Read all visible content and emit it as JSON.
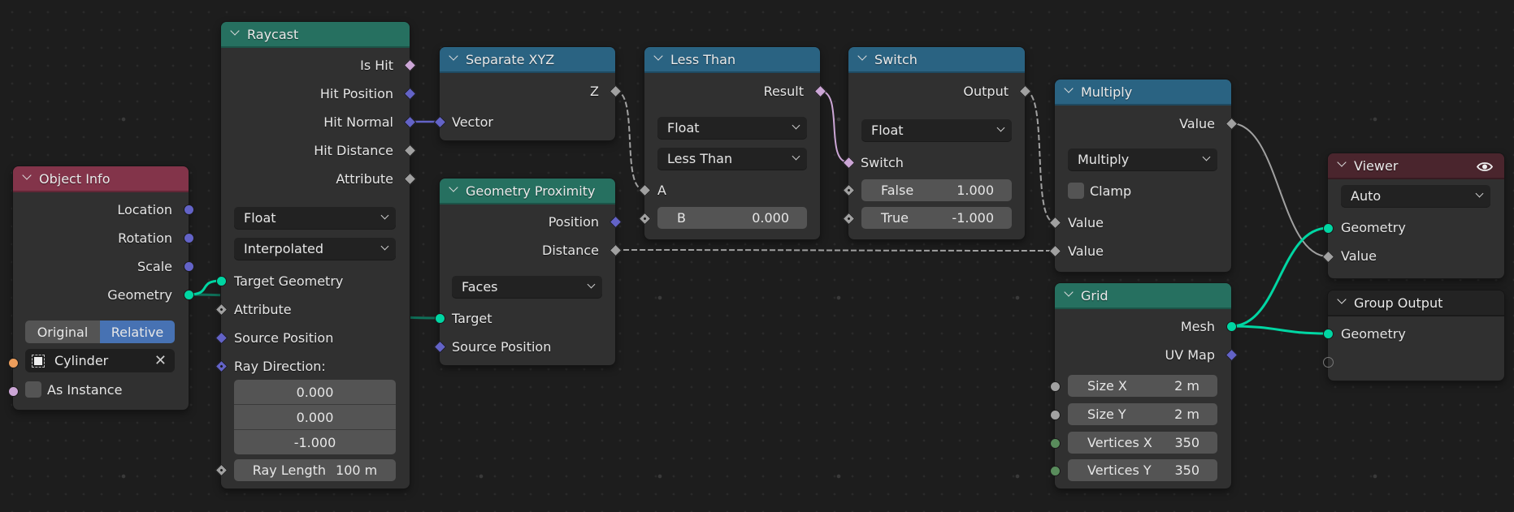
{
  "editor": "Geometry Node Editor",
  "colors": {
    "geometry_socket": "#00d6a3",
    "vector_socket": "#6363c7",
    "float_socket": "#a1a1a1",
    "boolean_socket": "#cca6d6",
    "object_socket": "#ed9e5c",
    "int_socket": "#598c5c",
    "geometry_header": "#267060",
    "converter_header": "#2a6382",
    "input_header": "#83344a",
    "output_header": "#4a252d",
    "toggle_active": "#4772b3"
  },
  "nodes": {
    "object_info": {
      "title": "Object Info",
      "outputs": [
        "Location",
        "Rotation",
        "Scale",
        "Geometry"
      ],
      "transform_space": {
        "options": [
          "Original",
          "Relative"
        ],
        "selected": "Relative"
      },
      "object": "Cylinder",
      "as_instance": {
        "label": "As Instance",
        "checked": false
      }
    },
    "raycast": {
      "title": "Raycast",
      "outputs": [
        "Is Hit",
        "Hit Position",
        "Hit Normal",
        "Hit Distance",
        "Attribute"
      ],
      "data_type": "Float",
      "mapping": "Interpolated",
      "inputs": [
        "Target Geometry",
        "Attribute",
        "Source Position",
        "Ray Direction:"
      ],
      "ray_direction": [
        "0.000",
        "0.000",
        "-1.000"
      ],
      "ray_length": {
        "label": "Ray Length",
        "value": "100 m"
      }
    },
    "separate_xyz": {
      "title": "Separate XYZ",
      "outputs": [
        "Z"
      ],
      "inputs": [
        "Vector"
      ]
    },
    "geometry_proximity": {
      "title": "Geometry Proximity",
      "outputs": [
        "Position",
        "Distance"
      ],
      "target_element": "Faces",
      "inputs": [
        "Target",
        "Source Position"
      ]
    },
    "less_than": {
      "title": "Less Than",
      "outputs": [
        "Result"
      ],
      "data_type": "Float",
      "operation": "Less Than",
      "inputs": [
        "A"
      ],
      "b": {
        "label": "B",
        "value": "0.000"
      }
    },
    "switch": {
      "title": "Switch",
      "outputs": [
        "Output"
      ],
      "data_type": "Float",
      "inputs": [
        "Switch"
      ],
      "false_field": {
        "label": "False",
        "value": "1.000"
      },
      "true_field": {
        "label": "True",
        "value": "-1.000"
      }
    },
    "multiply": {
      "title": "Multiply",
      "outputs": [
        "Value"
      ],
      "operation": "Multiply",
      "clamp": {
        "label": "Clamp",
        "checked": false
      },
      "inputs": [
        "Value",
        "Value"
      ]
    },
    "grid": {
      "title": "Grid",
      "outputs": [
        "Mesh",
        "UV Map"
      ],
      "fields": [
        {
          "label": "Size X",
          "value": "2 m"
        },
        {
          "label": "Size Y",
          "value": "2 m"
        },
        {
          "label": "Vertices X",
          "value": "350"
        },
        {
          "label": "Vertices Y",
          "value": "350"
        }
      ]
    },
    "viewer": {
      "title": "Viewer",
      "domain": "Auto",
      "inputs": [
        "Geometry",
        "Value"
      ]
    },
    "group_output": {
      "title": "Group Output",
      "inputs": [
        "Geometry"
      ]
    }
  }
}
